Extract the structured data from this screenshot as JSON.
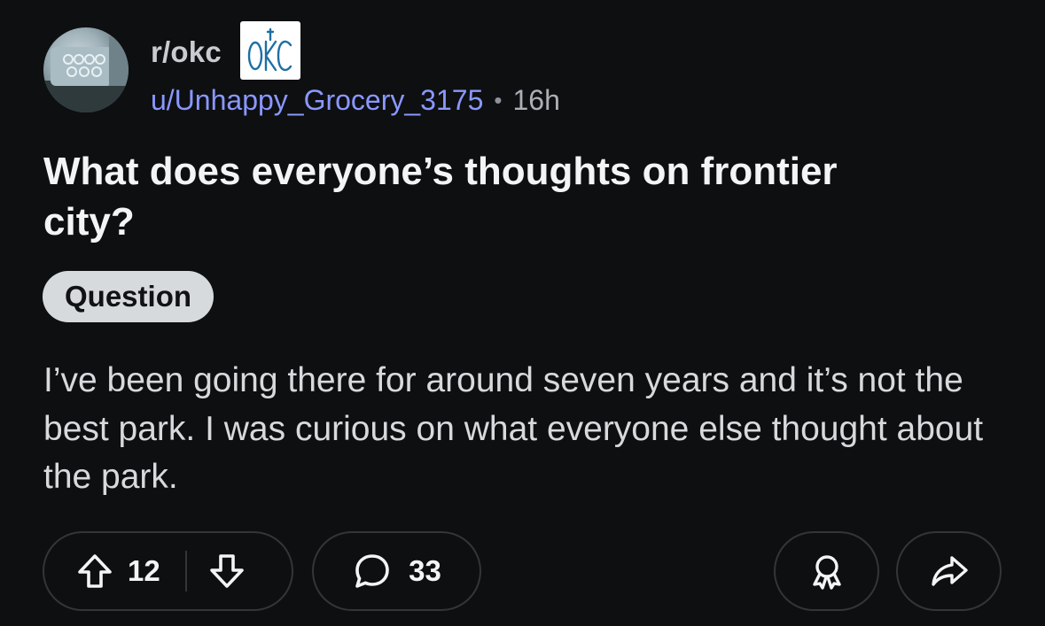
{
  "post": {
    "subreddit": "r/okc",
    "subreddit_badge_text": "OKC",
    "author": "u/Unhappy_Grocery_3175",
    "separator": "•",
    "age": "16h",
    "title": "What does everyone’s thoughts on frontier city?",
    "flair": "Question",
    "body": "I’ve been going there for around seven years and it’s not the best park. I was curious on what everyone else thought about the park."
  },
  "actions": {
    "upvotes": "12",
    "comments": "33",
    "icons": [
      "upvote-arrow-icon",
      "downvote-arrow-icon",
      "comment-bubble-icon",
      "award-icon",
      "share-arrow-icon"
    ]
  },
  "colors": {
    "background": "#0e0f11",
    "username": "#8a98ff",
    "flair_bg": "#d7dadc",
    "pill_border": "#343536"
  }
}
